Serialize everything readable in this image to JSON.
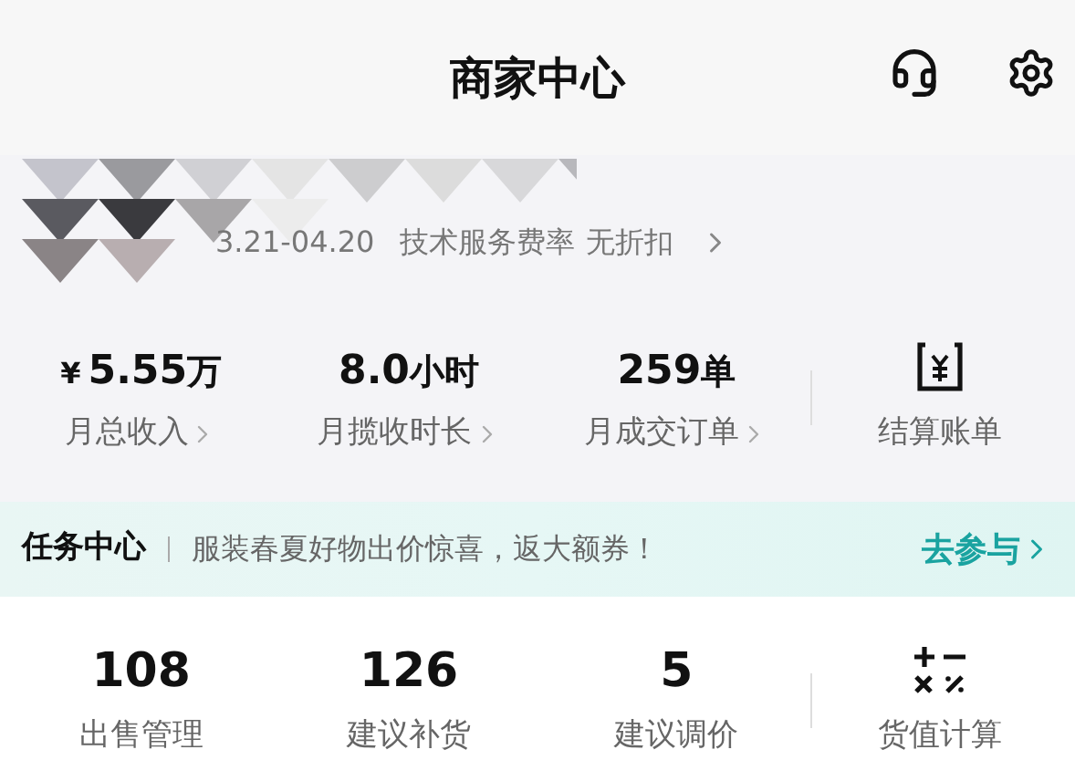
{
  "header": {
    "title": "商家中心"
  },
  "account": {
    "period": "3.21-04.20",
    "fee_label": "技术服务费率",
    "fee_value": "无折扣"
  },
  "stats": [
    {
      "kind": "metric",
      "prefix": "¥",
      "value": "5.55",
      "unit": "万",
      "label": "月总收入",
      "link": true
    },
    {
      "kind": "metric",
      "value": "8.0",
      "unit": "小时",
      "label": "月揽收时长",
      "link": true
    },
    {
      "kind": "metric",
      "value": "259",
      "unit": "单",
      "label": "月成交订单",
      "link": true
    },
    {
      "kind": "receipt",
      "label": "结算账单"
    }
  ],
  "task": {
    "title": "任务中心",
    "message": "服装春夏好物出价惊喜，返大额券！",
    "action": "去参与"
  },
  "tools": [
    {
      "kind": "metric",
      "value": "108",
      "label": "出售管理"
    },
    {
      "kind": "metric",
      "value": "126",
      "label": "建议补货"
    },
    {
      "kind": "metric",
      "value": "5",
      "label": "建议调价"
    },
    {
      "kind": "calculator",
      "label": "货值计算"
    }
  ]
}
